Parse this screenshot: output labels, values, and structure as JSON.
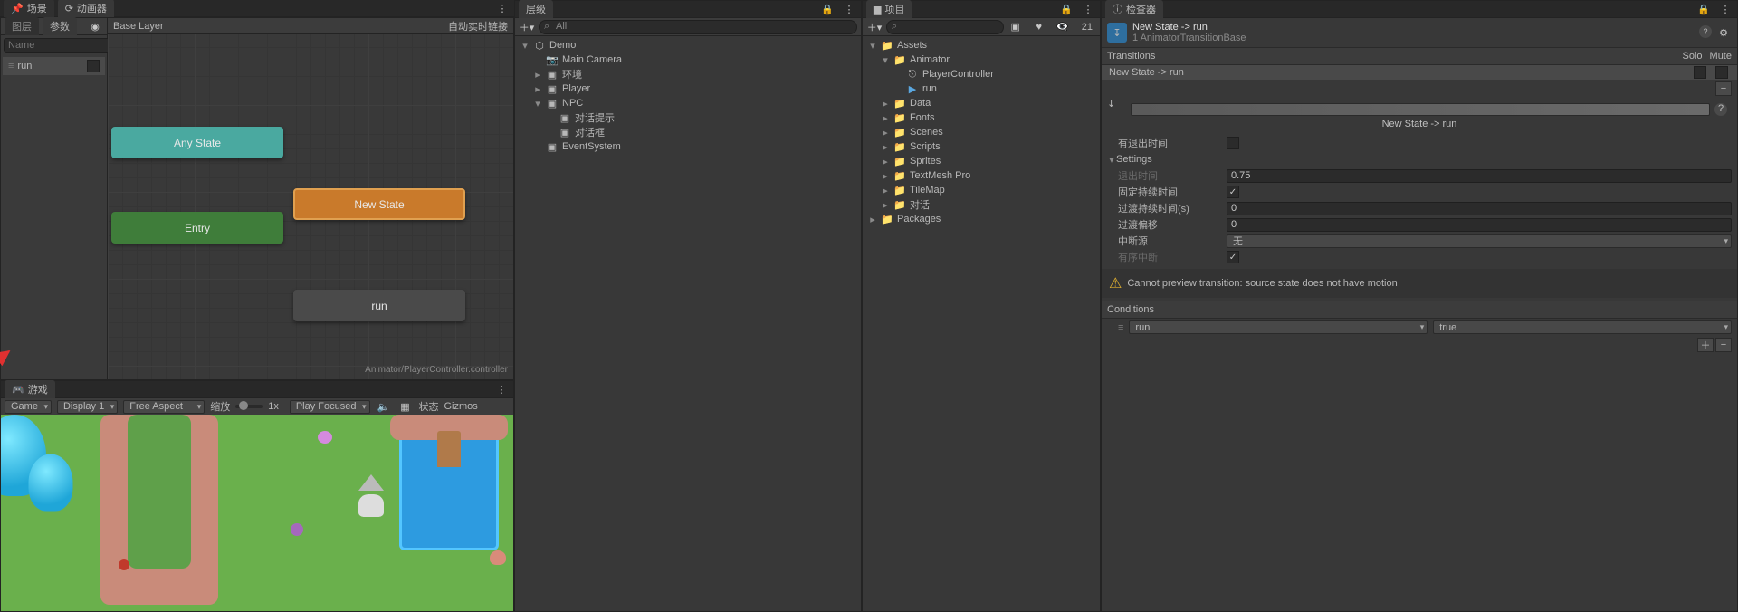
{
  "tabs": {
    "scene": "场景",
    "animator": "动画器",
    "hierarchy": "层级",
    "project": "项目",
    "inspector": "检查器",
    "game": "游戏"
  },
  "animator": {
    "sub_tabs": {
      "layers": "图层",
      "params": "参数"
    },
    "base_layer": "Base Layer",
    "auto_live_link": "自动实时链接",
    "search_placeholder": "Name",
    "params": [
      {
        "name": "run",
        "type": "bool"
      }
    ],
    "nodes": {
      "any": "Any State",
      "entry": "Entry",
      "new_state": "New State",
      "run": "run"
    },
    "footer_path": "Animator/PlayerController.controller"
  },
  "hierarchy": {
    "search_filter": "All",
    "root": "Demo",
    "items": [
      {
        "name": "Main Camera",
        "icon": "📷"
      },
      {
        "name": "环境",
        "icon": "▣"
      },
      {
        "name": "Player",
        "icon": "▣"
      },
      {
        "name": "NPC",
        "icon": "▣",
        "expanded": true,
        "children": [
          {
            "name": "对话提示",
            "icon": "▣",
            "dim": true
          },
          {
            "name": "对话框",
            "icon": "▣"
          }
        ]
      },
      {
        "name": "EventSystem",
        "icon": "▣"
      }
    ]
  },
  "project": {
    "hidden_count": "21",
    "root": "Assets",
    "tree": [
      {
        "name": "Animator",
        "icon": "📁",
        "expanded": true,
        "children": [
          {
            "name": "PlayerController",
            "icon": "⎋"
          },
          {
            "name": "run",
            "icon": "▶",
            "highlight": true
          }
        ]
      },
      {
        "name": "Data",
        "icon": "📁"
      },
      {
        "name": "Fonts",
        "icon": "📁"
      },
      {
        "name": "Scenes",
        "icon": "📁"
      },
      {
        "name": "Scripts",
        "icon": "📁"
      },
      {
        "name": "Sprites",
        "icon": "📁"
      },
      {
        "name": "TextMesh Pro",
        "icon": "📁"
      },
      {
        "name": "TileMap",
        "icon": "📁"
      },
      {
        "name": "对话",
        "icon": "📁"
      }
    ],
    "packages": "Packages"
  },
  "game_toolbar": {
    "game": "Game",
    "display": "Display 1",
    "aspect": "Free Aspect",
    "scale_label": "缩放",
    "scale_value": "1x",
    "play_focused": "Play Focused",
    "stats": "状态",
    "gizmos": "Gizmos"
  },
  "inspector": {
    "title": "New State -> run",
    "sub": "1 AnimatorTransitionBase",
    "transitions_hdr": "Transitions",
    "solo": "Solo",
    "mute": "Mute",
    "list_item": "New State -> run",
    "subtitle": "New State  ->  run",
    "has_exit_time": "有退出时间",
    "settings": "Settings",
    "exit_time": {
      "label": "退出时间",
      "value": "0.75"
    },
    "fixed_duration": {
      "label": "固定持续时间"
    },
    "trans_duration": {
      "label": "过渡持续时间(s)",
      "value": "0"
    },
    "trans_offset": {
      "label": "过渡偏移",
      "value": "0"
    },
    "int_source": {
      "label": "中断源",
      "value": "无"
    },
    "ordered_int": "有序中断",
    "warn": "Cannot preview transition: source state does not have motion",
    "conditions_hdr": "Conditions",
    "condition": {
      "param": "run",
      "value": "true"
    }
  }
}
